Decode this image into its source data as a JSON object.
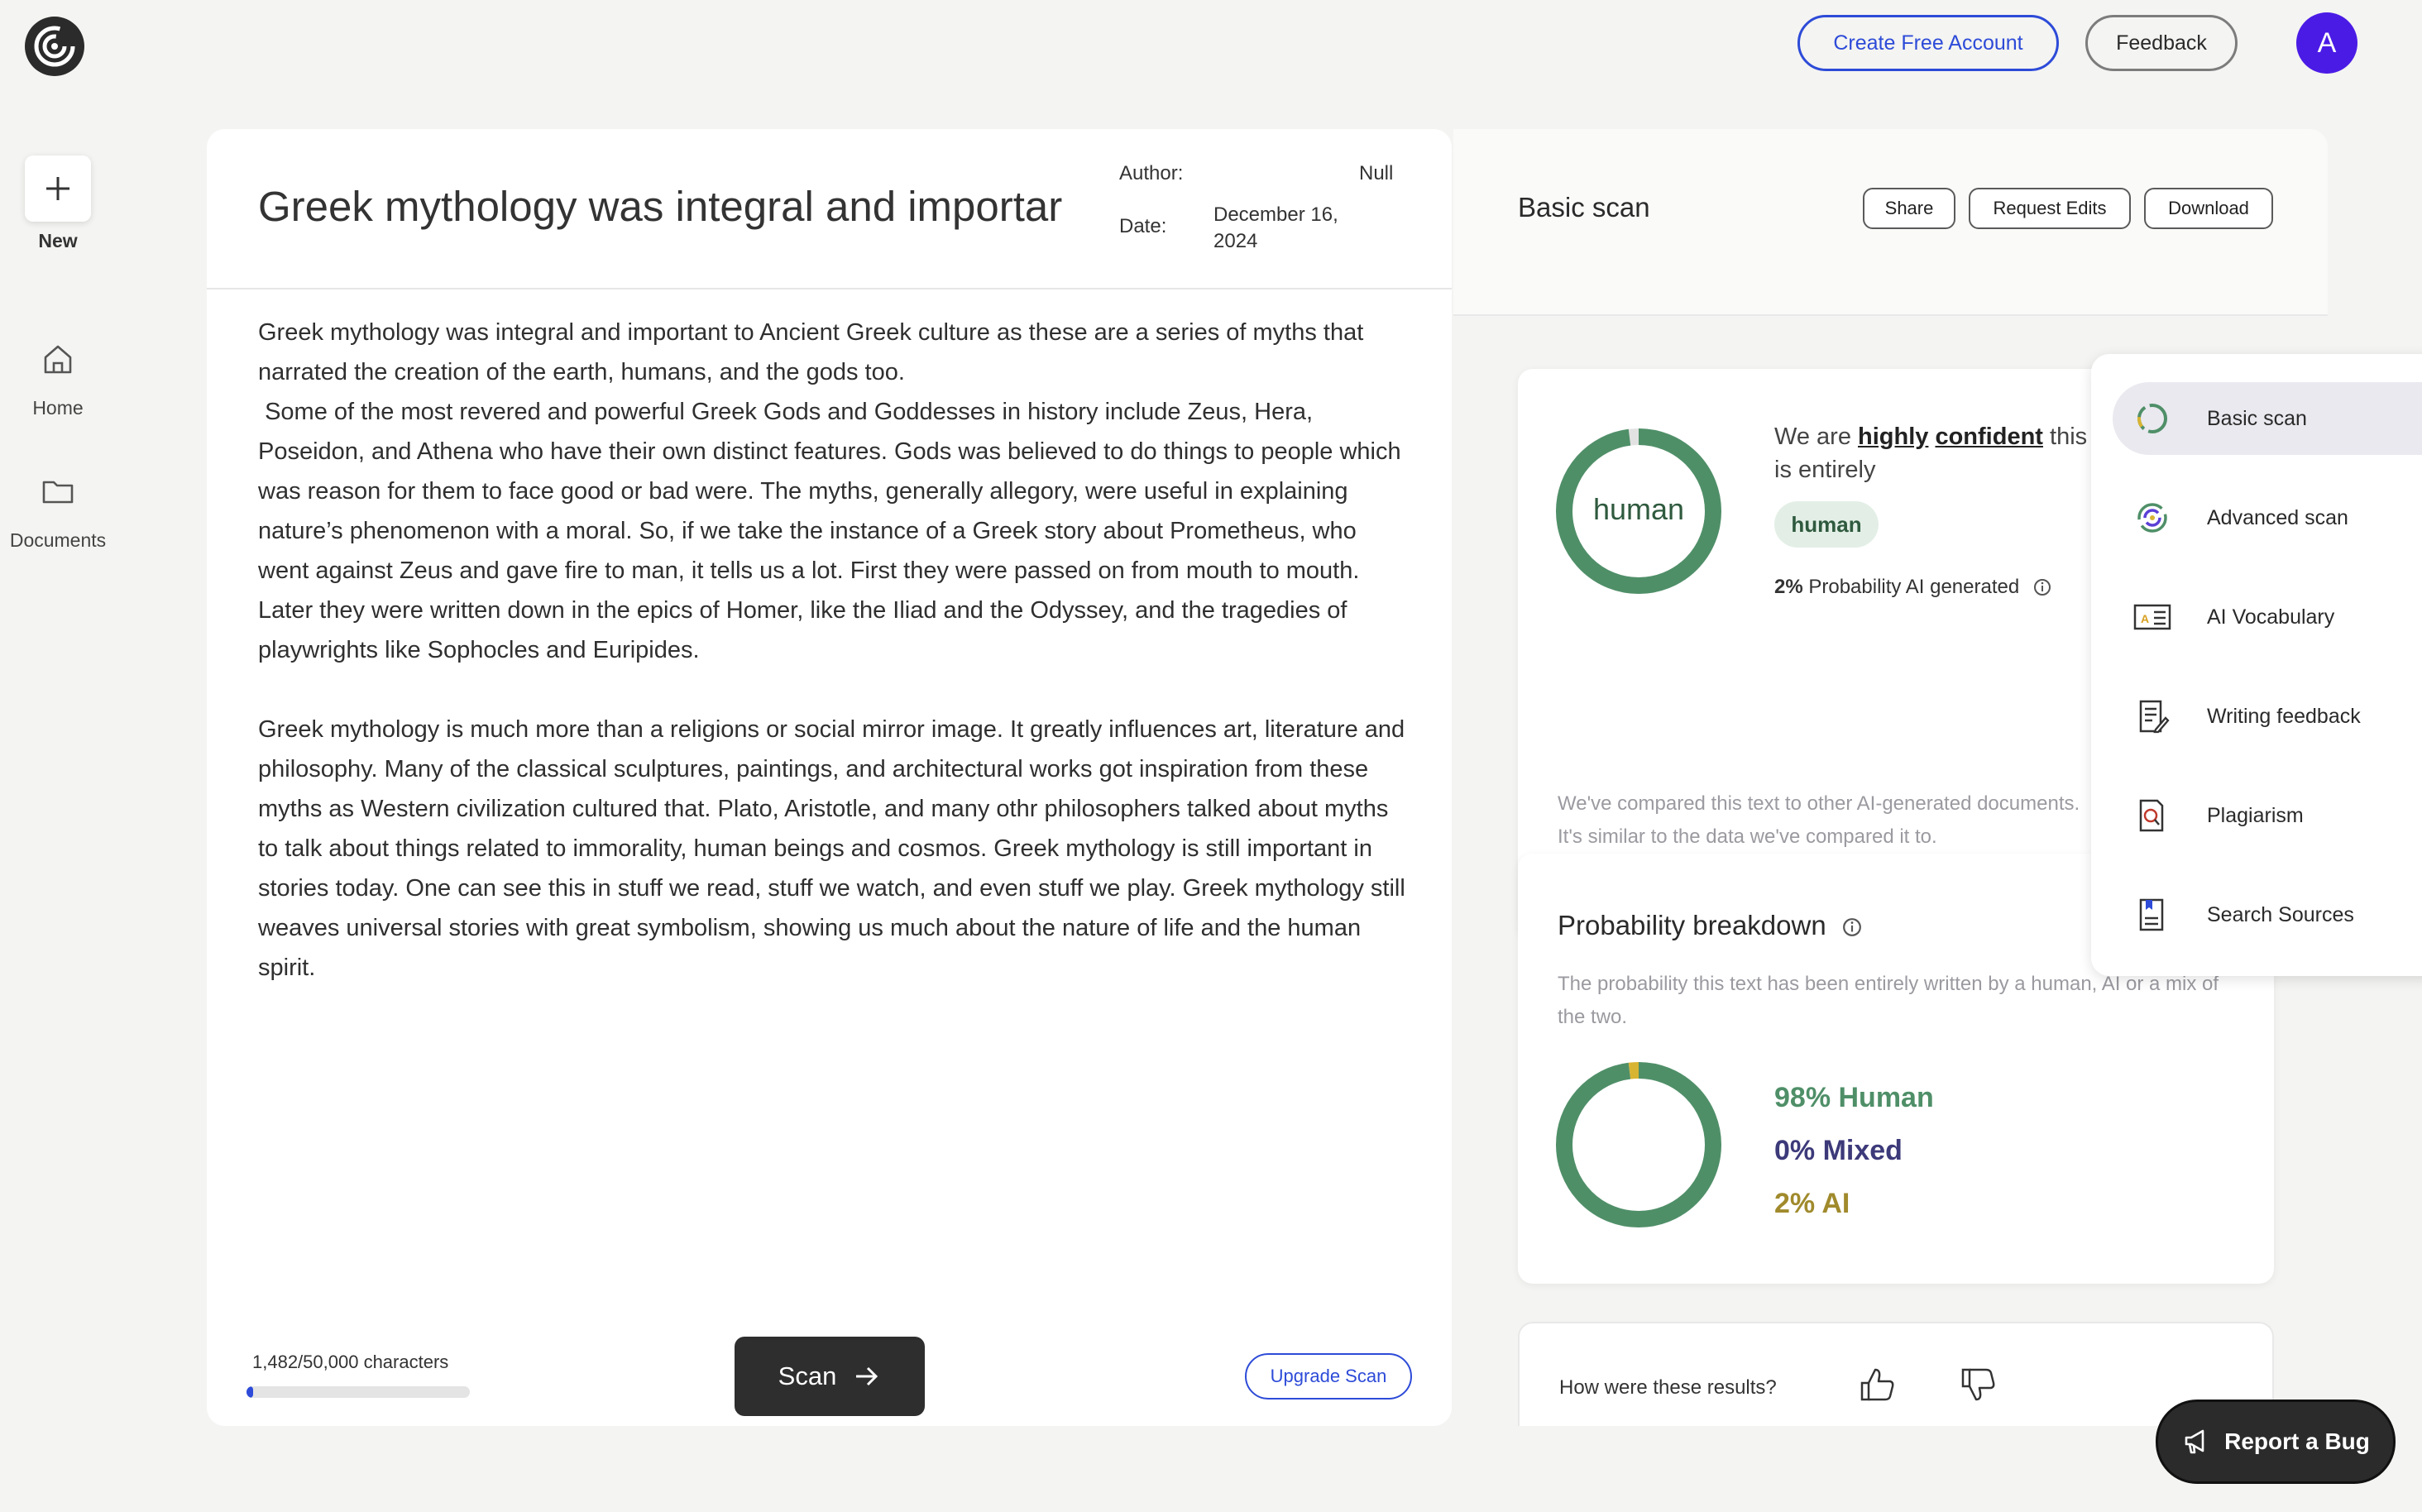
{
  "topbar": {
    "create_account": "Create Free Account",
    "feedback": "Feedback",
    "avatar_initial": "A"
  },
  "nav": {
    "new": "New",
    "home": "Home",
    "documents": "Documents"
  },
  "document": {
    "title": "Greek mythology was integral and importar",
    "author_label": "Author:",
    "author_value": "Null",
    "date_label": "Date:",
    "date_value": "December 16, 2024",
    "paragraphs": [
      "Greek mythology was integral and important to Ancient Greek culture as these are a series of myths that narrated the creation of the earth, humans, and the gods too.\n Some of the most revered and powerful Greek Gods and Goddesses in history include Zeus, Hera, Poseidon, and Athena who have their own distinct features. Gods was believed to do things to people which was reason for them to face good or bad were. The myths, generally allegory, were useful in explaining nature’s phenomenon with a moral. So, if we take the instance of a Greek story about Prometheus, who went against Zeus and gave fire to man, it tells us a lot. First they were passed on from mouth to mouth. Later they were written down in the epics of Homer, like the Iliad and the Odyssey, and the tragedies of playwrights like Sophocles and Euripides.",
      "Greek mythology is much more than a religions or social mirror image. It greatly influences art, literature and philosophy. Many of the classical sculptures, paintings, and architectural works got inspiration from these myths as Western civilization cultured that. Plato, Aristotle, and many othr philosophers talked about myths to talk about things related to immorality, human beings and cosmos. Greek mythology is still important in stories today. One can see this in stuff we read, stuff we watch, and even stuff we play. Greek mythology still weaves universal stories with great symbolism, showing us much about the nature of life and the human spirit."
    ],
    "char_count": "1,482/50,000 characters",
    "char_progress": 0.0296,
    "scan_button": "Scan",
    "upgrade_button": "Upgrade Scan"
  },
  "results": {
    "header_title": "Basic scan",
    "share": "Share",
    "request_edits": "Request Edits",
    "download": "Download",
    "donut_label": "human",
    "confidence_pre": "We are ",
    "confidence_word1": "highly",
    "confidence_word2": "confident",
    "confidence_post": " this text is entirely",
    "tag": "human",
    "prob_value": "2%",
    "prob_label": " Probability AI generated",
    "comparison_note": "We've compared this text to other AI-generated documents. It's similar to the data we've compared it to.",
    "breakdown_title": "Probability breakdown",
    "breakdown_desc": "The probability this text has been entirely written by a human, AI or a mix of the two.",
    "human_stat": "98% Human",
    "mixed_stat": "0% Mixed",
    "ai_stat": "2% AI",
    "human_pct": 98,
    "mixed_pct": 0,
    "ai_pct": 2,
    "feedback_question": "How were these results?"
  },
  "menu": {
    "items": [
      {
        "label": "Basic scan",
        "icon": "basic-scan-icon",
        "active": true
      },
      {
        "label": "Advanced scan",
        "icon": "advanced-scan-icon"
      },
      {
        "label": "AI Vocabulary",
        "icon": "ai-vocabulary-icon"
      },
      {
        "label": "Writing feedback",
        "icon": "writing-feedback-icon"
      },
      {
        "label": "Plagiarism",
        "icon": "plagiarism-icon"
      },
      {
        "label": "Search Sources",
        "icon": "search-sources-icon"
      }
    ]
  },
  "report_bug": "Report a Bug",
  "colors": {
    "accent": "#2d4bd8",
    "human": "#4f8f68",
    "mixed": "#3d3a7a",
    "ai": "#a08a2c",
    "avatar": "#4b1be6"
  }
}
